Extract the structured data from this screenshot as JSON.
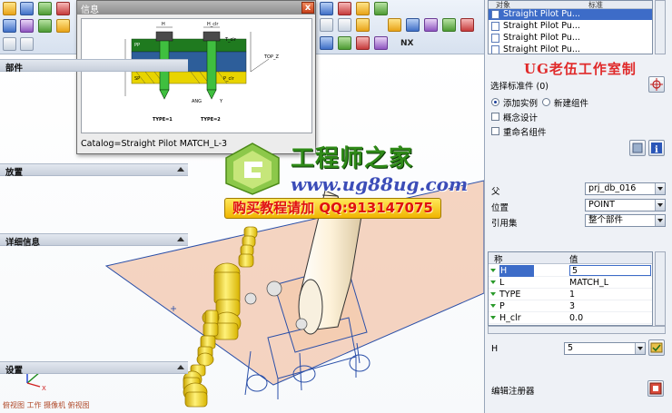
{
  "info_dialog": {
    "title": "信息",
    "close_symbol": "x",
    "catalog_text": "Catalog=Straight Pilot MATCH_L-3",
    "diagram": {
      "dim_H": "H",
      "dim_H_clr": "H_clr",
      "dim_T_clr": "T_clr",
      "dim_top_z": "TOP_Z",
      "dim_L": "L",
      "dim_P": "P",
      "dim_P_clr": "P_clr",
      "dim_ANG": "ANG",
      "dim_Y": "Y",
      "layer_PP": "PP",
      "layer_BP": "BP",
      "layer_SP": "SP",
      "type1_label": "TYPE=1",
      "type2_label": "TYPE=2"
    }
  },
  "watermark": {
    "title": "工程师之家",
    "url": "www.ug88ug.com",
    "badge": "购买教程请加 QQ:913147075",
    "panel_text": "UG老伍工作室制"
  },
  "viewport": {
    "status_text": "俯视图 工作 摄像机 俯视图"
  },
  "panel": {
    "catalog_table": {
      "col_object": "对象",
      "col_standard": "标准",
      "rows": [
        "Straight Pilot Pu...",
        "Straight Pilot Pu...",
        "Straight Pilot Pu...",
        "Straight Pilot Pu..."
      ]
    },
    "part_section": {
      "title": "部件",
      "select_standard": "选择标准件 (0)",
      "radio_add_instance": "添加实例",
      "radio_new_component": "新建组件",
      "check_concept": "概念设计",
      "check_rename": "重命名组件"
    },
    "placement_section": {
      "title": "放置",
      "parent_label": "父",
      "parent_value": "prj_db_016",
      "position_label": "位置",
      "position_value": "POINT",
      "refset_label": "引用集",
      "refset_value": "整个部件"
    },
    "details_section": {
      "title": "详细信息",
      "col_name": "称",
      "col_value": "值",
      "rows": [
        {
          "name": "H",
          "value": "5"
        },
        {
          "name": "L",
          "value": "MATCH_L"
        },
        {
          "name": "TYPE",
          "value": "1"
        },
        {
          "name": "P",
          "value": "3"
        },
        {
          "name": "H_clr",
          "value": "0.0"
        }
      ],
      "h_label": "H",
      "h_value": "5"
    },
    "settings_section": {
      "title": "设置",
      "edit_registry": "编辑注册器"
    }
  },
  "colors": {
    "accent_blue": "#3d6cc8",
    "plate_fill": "#f2c8b0",
    "plate_edge": "#2a4fa8",
    "pilot_yellow": "#ffe600",
    "watermark_green": "#2f8a18",
    "watermark_blue": "#3c4db8",
    "watermark_red": "#e01010"
  }
}
